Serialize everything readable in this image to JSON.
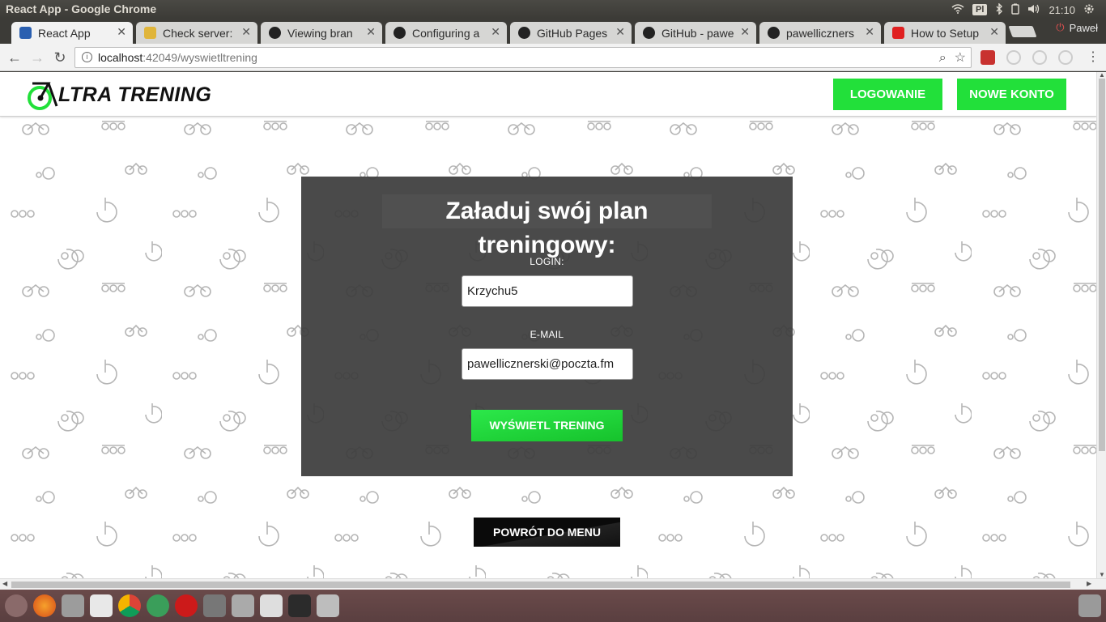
{
  "os": {
    "window_title": "React App - Google Chrome",
    "keyboard_layout": "Pl",
    "clock": "21:10",
    "user": "Paweł"
  },
  "tabs": [
    {
      "label": "React App",
      "favicon": "react-icon",
      "color": "#2a5fb0",
      "active": true
    },
    {
      "label": "Check server:",
      "favicon": "cloud-icon",
      "color": "#e0b53a",
      "active": false
    },
    {
      "label": "Viewing bran",
      "favicon": "github-icon",
      "color": "#222222",
      "active": false
    },
    {
      "label": "Configuring a",
      "favicon": "github-icon",
      "color": "#222222",
      "active": false
    },
    {
      "label": "GitHub Pages",
      "favicon": "github-icon",
      "color": "#222222",
      "active": false
    },
    {
      "label": "GitHub - pawe",
      "favicon": "github-icon",
      "color": "#222222",
      "active": false
    },
    {
      "label": "pawelliczners",
      "favicon": "github-icon",
      "color": "#222222",
      "active": false
    },
    {
      "label": "How to Setup",
      "favicon": "youtube-icon",
      "color": "#e02020",
      "active": false
    }
  ],
  "address": {
    "host": "localhost",
    "path": ":42049/wyswietltrening"
  },
  "navbar": {
    "logo_text": "LTRA TRENING",
    "login_label": "LOGOWANIE",
    "register_label": "NOWE KONTO",
    "accent": "#22e03a"
  },
  "form": {
    "title": "Załaduj swój plan treningowy:",
    "login_label": "LOGIN:",
    "login_value": "Krzychu5",
    "email_label": "E-MAIL",
    "email_value": "pawellicznerski@poczta.fm",
    "submit_label": "WYŚWIETL TRENING"
  },
  "back_button_label": "POWRÓT DO MENU"
}
